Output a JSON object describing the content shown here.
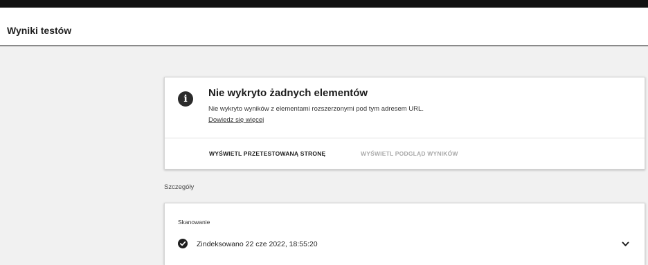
{
  "header": {
    "title": "Wyniki testów"
  },
  "result_card": {
    "icon": "info-icon",
    "title": "Nie wykryto żadnych elementów",
    "description": "Nie wykryto wyników z elementami rozszerzonymi pod tym adresem URL.",
    "learn_more": "Dowiedz się więcej",
    "actions": {
      "view_tested_page": "WYŚWIETL PRZETESTOWANĄ STRONĘ",
      "view_results_preview": "WYŚWIETL PODGLĄD WYNIKÓW"
    }
  },
  "details": {
    "label": "Szczegóły",
    "scan": {
      "label": "Skanowanie",
      "status_icon": "check-circle-icon",
      "status": "Zindeksowano 22 cze 2022, 18:55:20",
      "expand_icon": "chevron-down-icon"
    }
  },
  "colors": {
    "topbar": "#111111",
    "background": "#f1f1f1",
    "card": "#ffffff",
    "disabled_action": "#a9a9a9"
  }
}
